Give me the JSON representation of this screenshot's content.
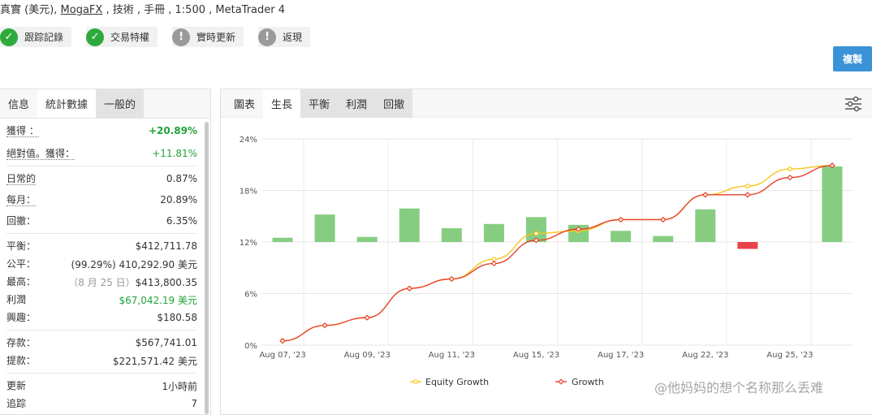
{
  "header": {
    "line_prefix": "真實 (美元), ",
    "broker": "MogaFX",
    "line_suffix": " , 技術 , 手冊 , 1:500 , MetaTrader 4"
  },
  "badges": [
    {
      "label": "跟踪記錄",
      "status": "ok",
      "icon": "check-icon"
    },
    {
      "label": "交易特權",
      "status": "ok",
      "icon": "check-icon"
    },
    {
      "label": "實時更新",
      "status": "warn",
      "icon": "exclamation-icon"
    },
    {
      "label": "返現",
      "status": "warn",
      "icon": "exclamation-icon"
    }
  ],
  "copy_button": "複製",
  "left_tabs": [
    "信息",
    "統計數據",
    "一般的"
  ],
  "stats": {
    "gain_label": "獲得 ：",
    "gain_value": "+20.89%",
    "abs_gain_label": "絕對值。獲得：",
    "abs_gain_value": "+11.81%",
    "daily_label": "日常的",
    "daily_value": "0.87%",
    "monthly_label": "每月：",
    "monthly_value": "20.89%",
    "drawdown_label": "回撤：",
    "drawdown_value": "6.35%",
    "balance_label": "平衡：",
    "balance_value": "$412,711.78",
    "equity_label": "公平：",
    "equity_value": "(99.29%) 410,292.90 美元",
    "highest_label": "最高：",
    "highest_date": "（8 月 25 日）",
    "highest_value": "$413,800.35",
    "profit_label": "利潤",
    "profit_value": "$67,042.19 美元",
    "interest_label": "興趣：",
    "interest_value": "$180.58",
    "deposits_label": "存款：",
    "deposits_value": "$567,741.01",
    "withdrawals_label": "提款：",
    "withdrawals_value": "$221,571.42 美元",
    "updated_label": "更新",
    "updated_value": "1小時前",
    "tracking_label": "追踪",
    "tracking_value": "7"
  },
  "right_tabs": [
    "圖表",
    "生長",
    "平衡",
    "利潤",
    "回撤"
  ],
  "colors": {
    "growth": "#e8412c",
    "equity": "#f5c518",
    "bar_pos": "#86cd82",
    "bar_neg": "#e8434a",
    "accent": "#3a93d6"
  },
  "chart_data": {
    "type": "line",
    "x_ticks": [
      "Aug 07, '23",
      "Aug 09, '23",
      "Aug 11, '23",
      "Aug 15, '23",
      "Aug 17, '23",
      "Aug 22, '23",
      "Aug 25, '23"
    ],
    "y_ticks": [
      "24%",
      "18%",
      "12%",
      "6%",
      "0%"
    ],
    "ylim": [
      0,
      24
    ],
    "grid": true,
    "legend_position": "bottom",
    "series": [
      {
        "name": "Growth",
        "points": [
          0.5,
          2.3,
          3.2,
          6.6,
          7.7,
          9.5,
          12.2,
          13.5,
          14.6,
          14.6,
          17.5,
          17.5,
          19.5,
          20.9
        ]
      },
      {
        "name": "Equity Growth",
        "points": [
          0.5,
          2.3,
          3.2,
          6.6,
          7.7,
          10.0,
          13.0,
          13.3,
          14.6,
          14.6,
          17.5,
          18.5,
          20.5,
          20.9
        ]
      }
    ],
    "bars": [
      0.5,
      3.2,
      0.6,
      3.9,
      1.6,
      2.1,
      2.9,
      2.0,
      1.3,
      0.7,
      3.8,
      -0.8,
      0,
      8.8
    ]
  }
}
